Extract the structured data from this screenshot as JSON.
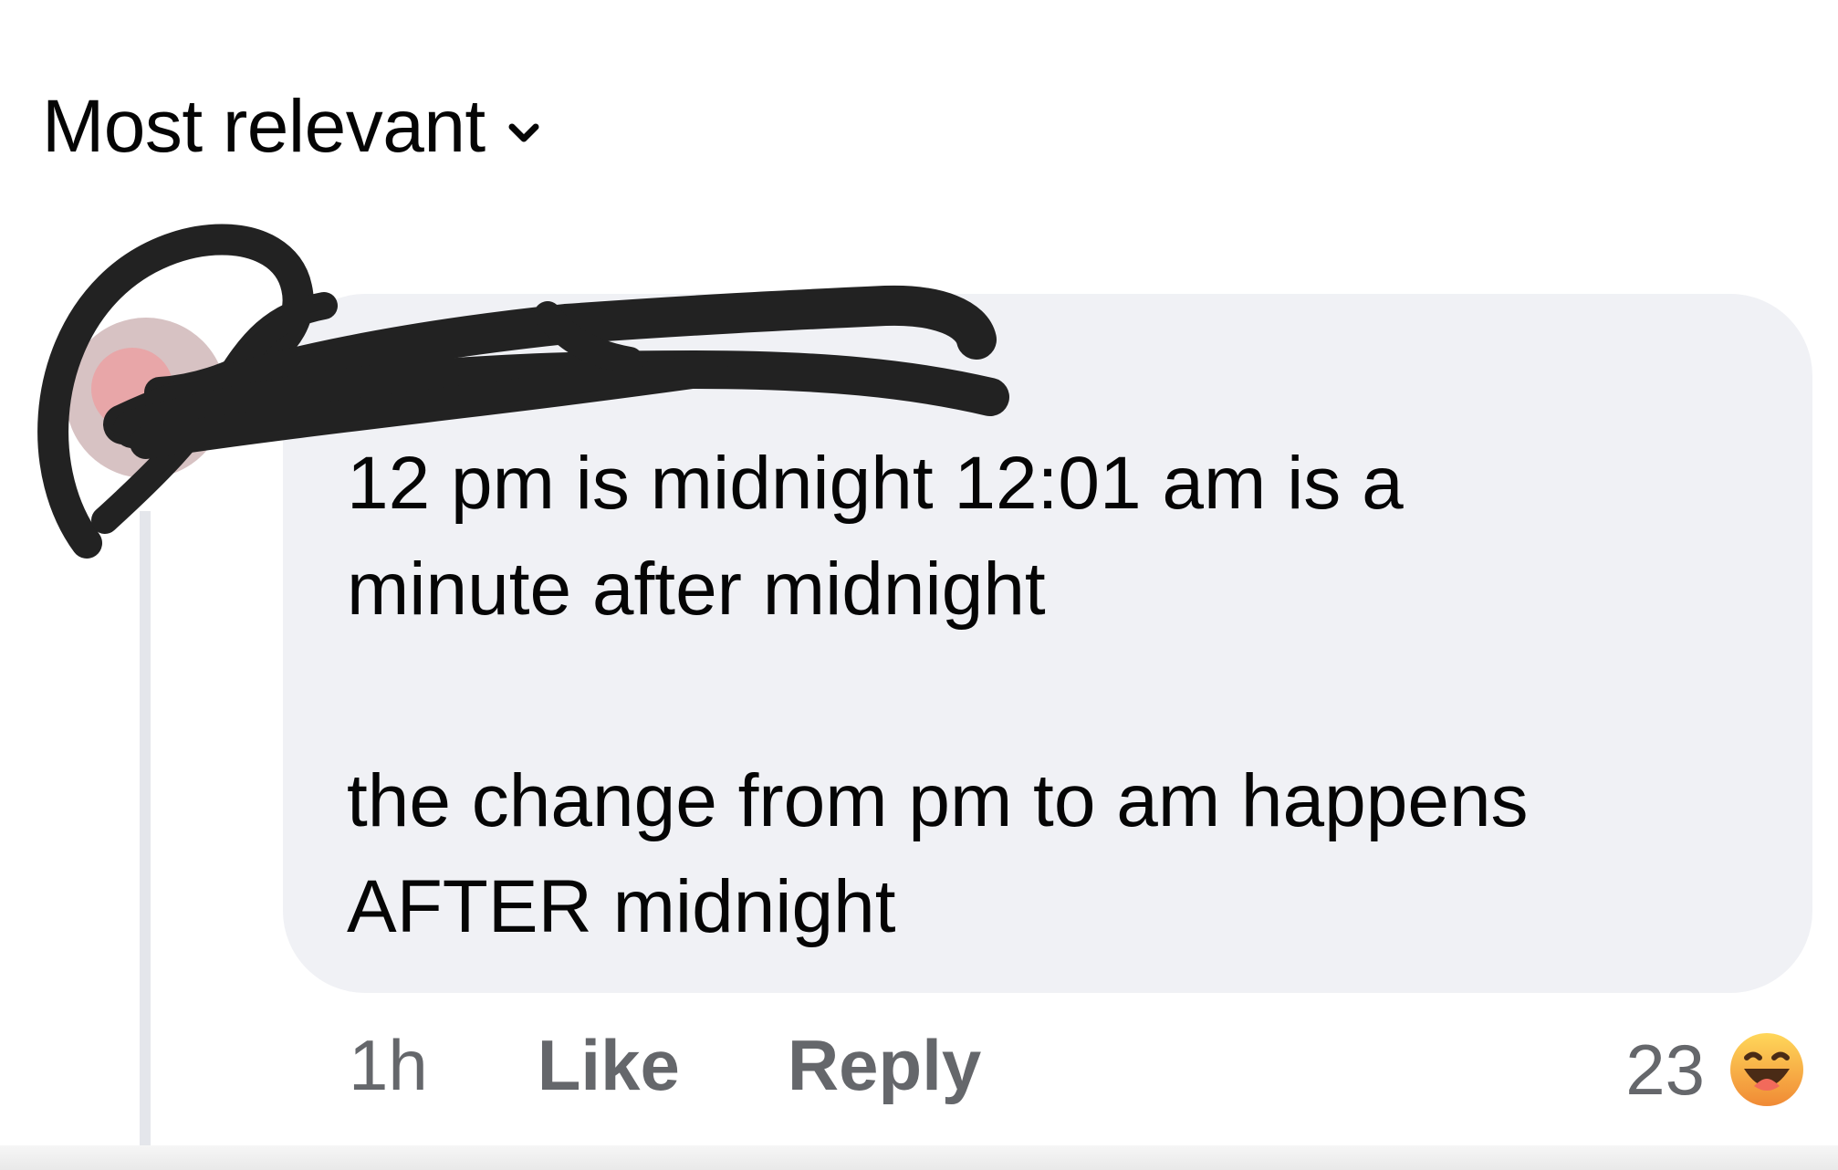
{
  "sort": {
    "label": "Most relevant",
    "icon": "chevron-down-icon"
  },
  "comment": {
    "text": "12 pm is midnight 12:01 am is a\nminute after midnight\n\nthe change from pm to am happens\nAFTER midnight",
    "timestamp": "1h",
    "like_label": "Like",
    "reply_label": "Reply",
    "reaction_count": "23",
    "reaction_icon": "haha-emoji-icon"
  },
  "colors": {
    "bubble": "#f0f1f5",
    "meta_text": "#65676b",
    "redaction": "#222222",
    "haha_top": "#ffd75a",
    "haha_bottom": "#f08a35"
  }
}
